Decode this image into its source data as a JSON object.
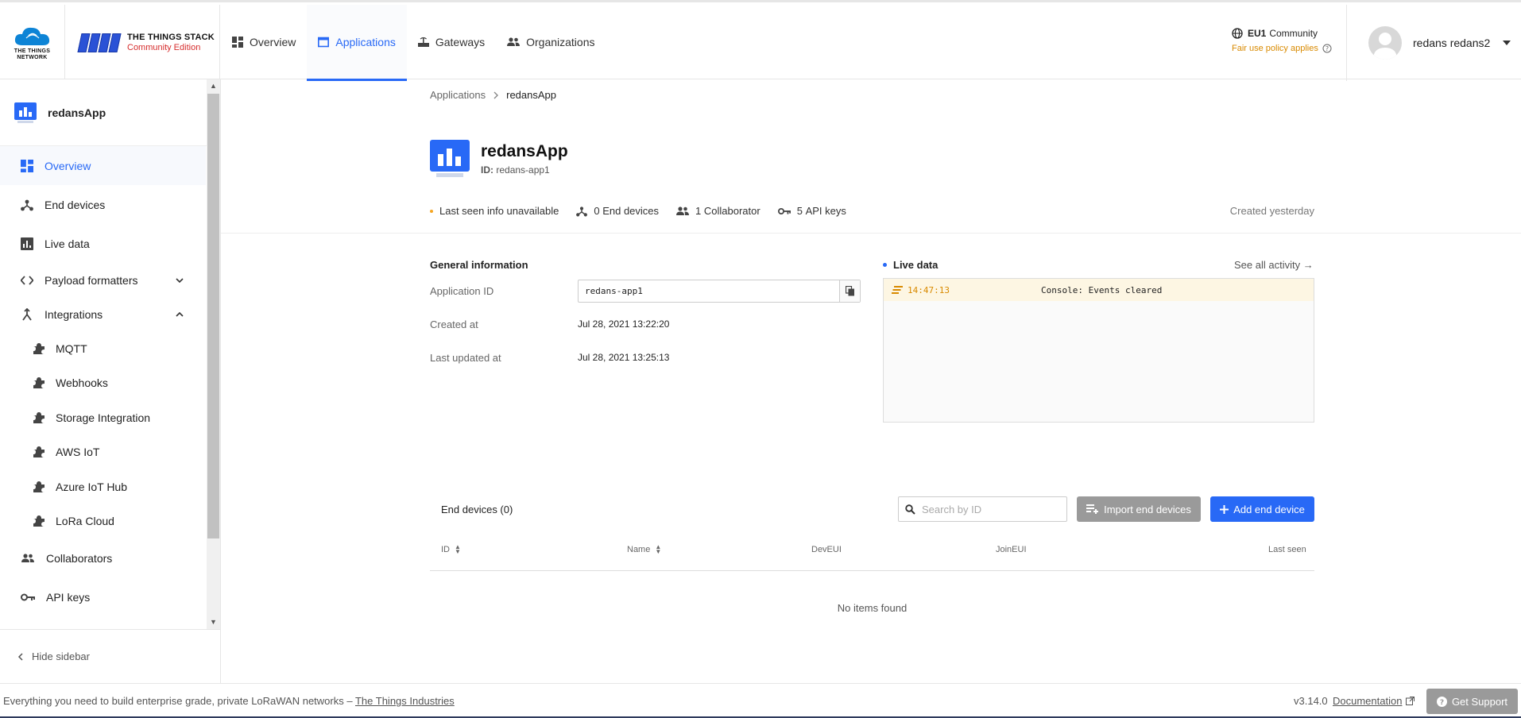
{
  "brand": {
    "ttn_logo_line1": "THE THINGS",
    "ttn_logo_line2": "NETWORK",
    "stack_title": "THE THINGS STACK",
    "stack_subtitle": "Community Edition"
  },
  "nav": {
    "items": [
      {
        "label": "Overview",
        "icon": "dashboard-icon"
      },
      {
        "label": "Applications",
        "icon": "application-icon",
        "active": true
      },
      {
        "label": "Gateways",
        "icon": "gateway-icon"
      },
      {
        "label": "Organizations",
        "icon": "organization-icon"
      }
    ]
  },
  "cluster": {
    "region": "EU1",
    "label": "Community",
    "fair_use": "Fair use policy applies"
  },
  "user": {
    "name": "redans redans2"
  },
  "sidebar": {
    "app_name": "redansApp",
    "items": [
      {
        "label": "Overview"
      },
      {
        "label": "End devices"
      },
      {
        "label": "Live data"
      },
      {
        "label": "Payload formatters"
      },
      {
        "label": "Integrations"
      }
    ],
    "integrations": [
      {
        "label": "MQTT"
      },
      {
        "label": "Webhooks"
      },
      {
        "label": "Storage Integration"
      },
      {
        "label": "AWS IoT"
      },
      {
        "label": "Azure IoT Hub"
      },
      {
        "label": "LoRa Cloud"
      }
    ],
    "after": [
      {
        "label": "Collaborators"
      },
      {
        "label": "API keys"
      }
    ],
    "hide_label": "Hide sidebar"
  },
  "breadcrumb": {
    "root": "Applications",
    "current": "redansApp"
  },
  "app": {
    "name": "redansApp",
    "id_label": "ID:",
    "id_value": "redans-app1"
  },
  "stats": {
    "last_seen": "Last seen info unavailable",
    "end_devices_count": "0",
    "end_devices_label": "End devices",
    "collab_count": "1",
    "collab_label": "Collaborator",
    "api_count": "5",
    "api_label": "API keys",
    "created": "Created yesterday"
  },
  "general": {
    "title": "General information",
    "app_id_label": "Application ID",
    "app_id_value": "redans-app1",
    "created_label": "Created at",
    "created_value": "Jul 28, 2021 13:22:20",
    "updated_label": "Last updated at",
    "updated_value": "Jul 28, 2021 13:25:13"
  },
  "live": {
    "title": "Live data",
    "see_all": "See all activity →",
    "events": [
      {
        "time": "14:47:13",
        "message": "Console: Events cleared"
      }
    ]
  },
  "end_devices": {
    "title": "End devices (0)",
    "search_placeholder": "Search by ID",
    "import_label": "Import end devices",
    "add_label": "Add end device",
    "columns": [
      "ID",
      "Name",
      "DevEUI",
      "JoinEUI",
      "Last seen"
    ],
    "empty": "No items found"
  },
  "footer": {
    "tagline": "Everything you need to build enterprise grade, private LoRaWAN networks –",
    "tti_link": "The Things Industries",
    "version": "v3.14.0",
    "docs": "Documentation",
    "support": "Get Support"
  },
  "colors": {
    "accent": "#2869f6",
    "warning": "#d98a00",
    "brand_red": "#d62d2d"
  }
}
